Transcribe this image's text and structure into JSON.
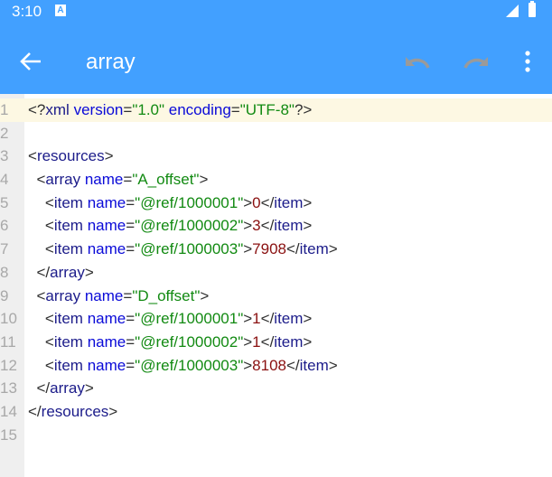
{
  "status_bar": {
    "time": "3:10",
    "notification_icon": "A"
  },
  "toolbar": {
    "title": "array",
    "back_icon": "arrow-left",
    "undo_icon": "undo",
    "redo_icon": "redo",
    "more_icon": "more-vert"
  },
  "colors": {
    "appbar": "#42a0ff",
    "tag": "#1c1c8a",
    "attr": "#0a0ad8",
    "string": "#128a12",
    "value": "#8a1010",
    "current_line": "#fdf8e3"
  },
  "editor": {
    "current_line": 1,
    "lines": [
      [
        [
          "punct",
          "<?"
        ],
        [
          "tag",
          "xml"
        ],
        [
          "punct",
          " "
        ],
        [
          "attr",
          "version"
        ],
        [
          "punct",
          "="
        ],
        [
          "str",
          "\"1.0\""
        ],
        [
          "punct",
          " "
        ],
        [
          "attr",
          "encoding"
        ],
        [
          "punct",
          "="
        ],
        [
          "str",
          "\"UTF-8\""
        ],
        [
          "punct",
          "?>"
        ]
      ],
      [],
      [
        [
          "punct",
          "<"
        ],
        [
          "tag",
          "resources"
        ],
        [
          "punct",
          ">"
        ]
      ],
      [
        [
          "punct",
          "  <"
        ],
        [
          "tag",
          "array"
        ],
        [
          "punct",
          " "
        ],
        [
          "attr",
          "name"
        ],
        [
          "punct",
          "="
        ],
        [
          "str",
          "\"A_offset\""
        ],
        [
          "punct",
          ">"
        ]
      ],
      [
        [
          "punct",
          "    <"
        ],
        [
          "tag",
          "item"
        ],
        [
          "punct",
          " "
        ],
        [
          "attr",
          "name"
        ],
        [
          "punct",
          "="
        ],
        [
          "str",
          "\"@ref/1000001\""
        ],
        [
          "punct",
          ">"
        ],
        [
          "val",
          "0"
        ],
        [
          "punct",
          "</"
        ],
        [
          "tag",
          "item"
        ],
        [
          "punct",
          ">"
        ]
      ],
      [
        [
          "punct",
          "    <"
        ],
        [
          "tag",
          "item"
        ],
        [
          "punct",
          " "
        ],
        [
          "attr",
          "name"
        ],
        [
          "punct",
          "="
        ],
        [
          "str",
          "\"@ref/1000002\""
        ],
        [
          "punct",
          ">"
        ],
        [
          "val",
          "3"
        ],
        [
          "punct",
          "</"
        ],
        [
          "tag",
          "item"
        ],
        [
          "punct",
          ">"
        ]
      ],
      [
        [
          "punct",
          "    <"
        ],
        [
          "tag",
          "item"
        ],
        [
          "punct",
          " "
        ],
        [
          "attr",
          "name"
        ],
        [
          "punct",
          "="
        ],
        [
          "str",
          "\"@ref/1000003\""
        ],
        [
          "punct",
          ">"
        ],
        [
          "val",
          "7908"
        ],
        [
          "punct",
          "</"
        ],
        [
          "tag",
          "item"
        ],
        [
          "punct",
          ">"
        ]
      ],
      [
        [
          "punct",
          "  </"
        ],
        [
          "tag",
          "array"
        ],
        [
          "punct",
          ">"
        ]
      ],
      [
        [
          "punct",
          "  <"
        ],
        [
          "tag",
          "array"
        ],
        [
          "punct",
          " "
        ],
        [
          "attr",
          "name"
        ],
        [
          "punct",
          "="
        ],
        [
          "str",
          "\"D_offset\""
        ],
        [
          "punct",
          ">"
        ]
      ],
      [
        [
          "punct",
          "    <"
        ],
        [
          "tag",
          "item"
        ],
        [
          "punct",
          " "
        ],
        [
          "attr",
          "name"
        ],
        [
          "punct",
          "="
        ],
        [
          "str",
          "\"@ref/1000001\""
        ],
        [
          "punct",
          ">"
        ],
        [
          "val",
          "1"
        ],
        [
          "punct",
          "</"
        ],
        [
          "tag",
          "item"
        ],
        [
          "punct",
          ">"
        ]
      ],
      [
        [
          "punct",
          "    <"
        ],
        [
          "tag",
          "item"
        ],
        [
          "punct",
          " "
        ],
        [
          "attr",
          "name"
        ],
        [
          "punct",
          "="
        ],
        [
          "str",
          "\"@ref/1000002\""
        ],
        [
          "punct",
          ">"
        ],
        [
          "val",
          "1"
        ],
        [
          "punct",
          "</"
        ],
        [
          "tag",
          "item"
        ],
        [
          "punct",
          ">"
        ]
      ],
      [
        [
          "punct",
          "    <"
        ],
        [
          "tag",
          "item"
        ],
        [
          "punct",
          " "
        ],
        [
          "attr",
          "name"
        ],
        [
          "punct",
          "="
        ],
        [
          "str",
          "\"@ref/1000003\""
        ],
        [
          "punct",
          ">"
        ],
        [
          "val",
          "8108"
        ],
        [
          "punct",
          "</"
        ],
        [
          "tag",
          "item"
        ],
        [
          "punct",
          ">"
        ]
      ],
      [
        [
          "punct",
          "  </"
        ],
        [
          "tag",
          "array"
        ],
        [
          "punct",
          ">"
        ]
      ],
      [
        [
          "punct",
          "</"
        ],
        [
          "tag",
          "resources"
        ],
        [
          "punct",
          ">"
        ]
      ],
      []
    ]
  }
}
